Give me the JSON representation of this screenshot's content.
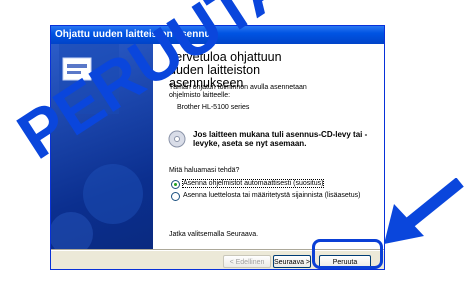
{
  "window": {
    "title": "Ohjattu uuden laitteiston asennus"
  },
  "content": {
    "heading": "Tervetuloa ohjattuun uuden laitteiston asennukseen",
    "intro": "Tämän ohjatun toiminnon avulla asennetaan ohjelmisto laitteelle:",
    "device": "Brother HL-5100 series",
    "cd_instruction": "Jos laitteen mukana tuli asennus-CD-levy tai -levyke, aseta se nyt asemaan.",
    "question": "Mitä haluamasi tehdä?",
    "options": [
      {
        "label": "Asenna ohjelmistot automaattisesti (suositus)",
        "selected": true
      },
      {
        "label": "Asenna luettelosta tai määritetystä sijainnista (lisäasetus)",
        "selected": false
      }
    ],
    "continue_hint": "Jatka valitsemalla Seuraava."
  },
  "buttons": {
    "back": "< Edellinen",
    "next": "Seuraava >",
    "cancel": "Peruuta"
  },
  "overlay": {
    "watermark": "PERUUTA",
    "color": "#0a46dc"
  }
}
